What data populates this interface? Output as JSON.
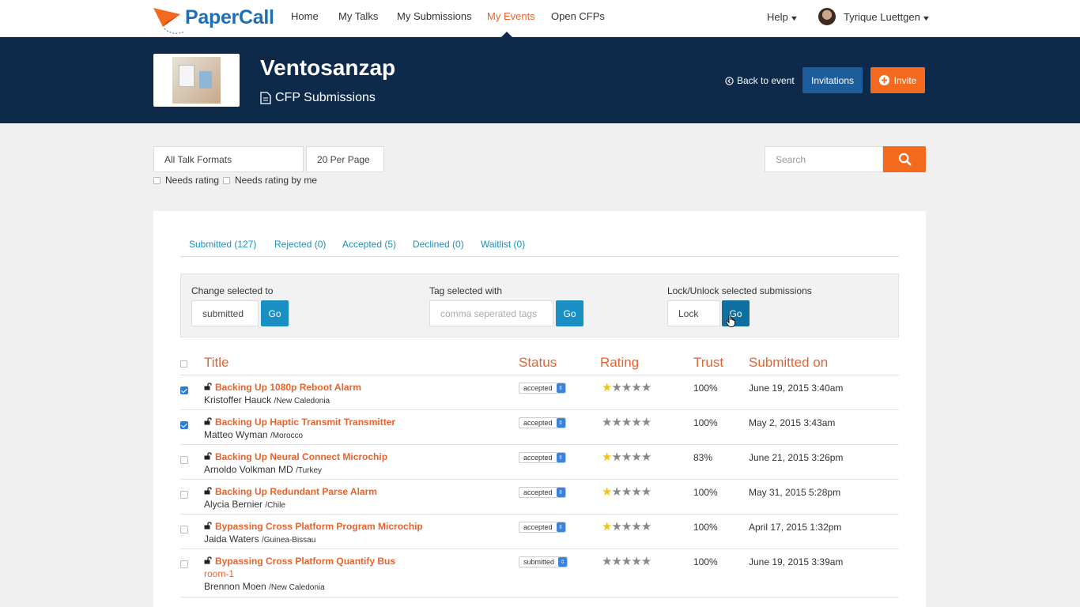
{
  "nav": {
    "brand": "PaperCall",
    "items": [
      {
        "label": "Home",
        "active": false
      },
      {
        "label": "My Talks",
        "active": false
      },
      {
        "label": "My Submissions",
        "active": false
      },
      {
        "label": "My Events",
        "active": true
      },
      {
        "label": "Open CFPs",
        "active": false
      }
    ],
    "help": "Help",
    "user": "Tyrique Luettgen"
  },
  "event": {
    "title": "Ventosanzap",
    "subtitle": "CFP Submissions",
    "back": "Back to event",
    "invitations": "Invitations",
    "invite": "Invite"
  },
  "filters": {
    "formats": "All Talk Formats",
    "per_page": "20 Per Page",
    "needs_rating": "Needs rating",
    "needs_rating_me": "Needs rating by me",
    "search_placeholder": "Search"
  },
  "tabs": [
    {
      "label": "Submitted (127)"
    },
    {
      "label": "Rejected (0)"
    },
    {
      "label": "Accepted (5)"
    },
    {
      "label": "Declined (0)"
    },
    {
      "label": "Waitlist (0)"
    }
  ],
  "bulk": {
    "change_label": "Change selected to",
    "change_value": "submitted",
    "tag_label": "Tag selected with",
    "tag_placeholder": "comma seperated tags",
    "lock_label": "Lock/Unlock selected submissions",
    "lock_value": "Lock",
    "go": "Go"
  },
  "table": {
    "headers": {
      "title": "Title",
      "status": "Status",
      "rating": "Rating",
      "trust": "Trust",
      "submitted": "Submitted on"
    },
    "rows": [
      {
        "checked": true,
        "title": "Backing Up 1080p Reboot Alarm",
        "room": "",
        "speaker": "Kristoffer Hauck",
        "location": "/New Caledonia",
        "status": "accepted",
        "stars_filled": 1,
        "trust": "100%",
        "date": "June 19, 2015 3:40am"
      },
      {
        "checked": true,
        "title": "Backing Up Haptic Transmit Transmitter",
        "room": "",
        "speaker": "Matteo Wyman",
        "location": "/Morocco",
        "status": "accepted",
        "stars_filled": 0,
        "trust": "100%",
        "date": "May 2, 2015 3:43am"
      },
      {
        "checked": false,
        "title": "Backing Up Neural Connect Microchip",
        "room": "",
        "speaker": "Arnoldo Volkman MD",
        "location": "/Turkey",
        "status": "accepted",
        "stars_filled": 1,
        "trust": "83%",
        "date": "June 21, 2015 3:26pm"
      },
      {
        "checked": false,
        "title": "Backing Up Redundant Parse Alarm",
        "room": "",
        "speaker": "Alycia Bernier",
        "location": "/Chile",
        "status": "accepted",
        "stars_filled": 1,
        "trust": "100%",
        "date": "May 31, 2015 5:28pm"
      },
      {
        "checked": false,
        "title": "Bypassing Cross Platform Program Microchip",
        "room": "",
        "speaker": "Jaida Waters",
        "location": "/Guinea-Bissau",
        "status": "accepted",
        "stars_filled": 1,
        "trust": "100%",
        "date": "April 17, 2015 1:32pm"
      },
      {
        "checked": false,
        "title": "Bypassing Cross Platform Quantify Bus",
        "room": "room-1",
        "speaker": "Brennon Moen",
        "location": "/New Caledonia",
        "status": "submitted",
        "stars_filled": 0,
        "trust": "100%",
        "date": "June 19, 2015 3:39am"
      }
    ]
  },
  "colors": {
    "brand_blue": "#0d2a4a",
    "accent_orange": "#f36a1f",
    "link_blue": "#1a8fc4",
    "star_gold": "#f2c313"
  }
}
